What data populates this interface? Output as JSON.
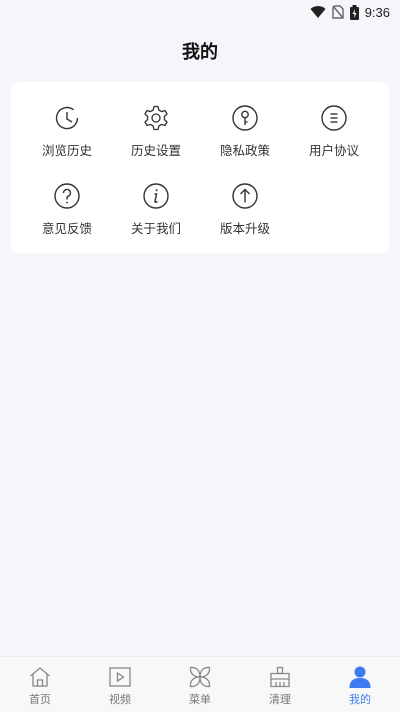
{
  "status_bar": {
    "time": "9:36"
  },
  "header": {
    "title": "我的"
  },
  "menu": {
    "items": [
      {
        "label": "浏览历史",
        "icon": "clock-icon"
      },
      {
        "label": "历史设置",
        "icon": "gear-icon"
      },
      {
        "label": "隐私政策",
        "icon": "key-icon"
      },
      {
        "label": "用户协议",
        "icon": "list-icon"
      },
      {
        "label": "意见反馈",
        "icon": "question-icon"
      },
      {
        "label": "关于我们",
        "icon": "info-icon"
      },
      {
        "label": "版本升级",
        "icon": "upgrade-arrow-icon"
      }
    ]
  },
  "bottom_nav": {
    "items": [
      {
        "label": "首页",
        "icon": "home-icon"
      },
      {
        "label": "视频",
        "icon": "video-icon"
      },
      {
        "label": "菜单",
        "icon": "grid-menu-icon"
      },
      {
        "label": "清理",
        "icon": "broom-icon"
      },
      {
        "label": "我的",
        "icon": "user-icon"
      }
    ],
    "active_index": 4
  },
  "colors": {
    "accent": "#3d7bf0",
    "icon_stroke": "#333333",
    "background": "#f5f6fa"
  }
}
